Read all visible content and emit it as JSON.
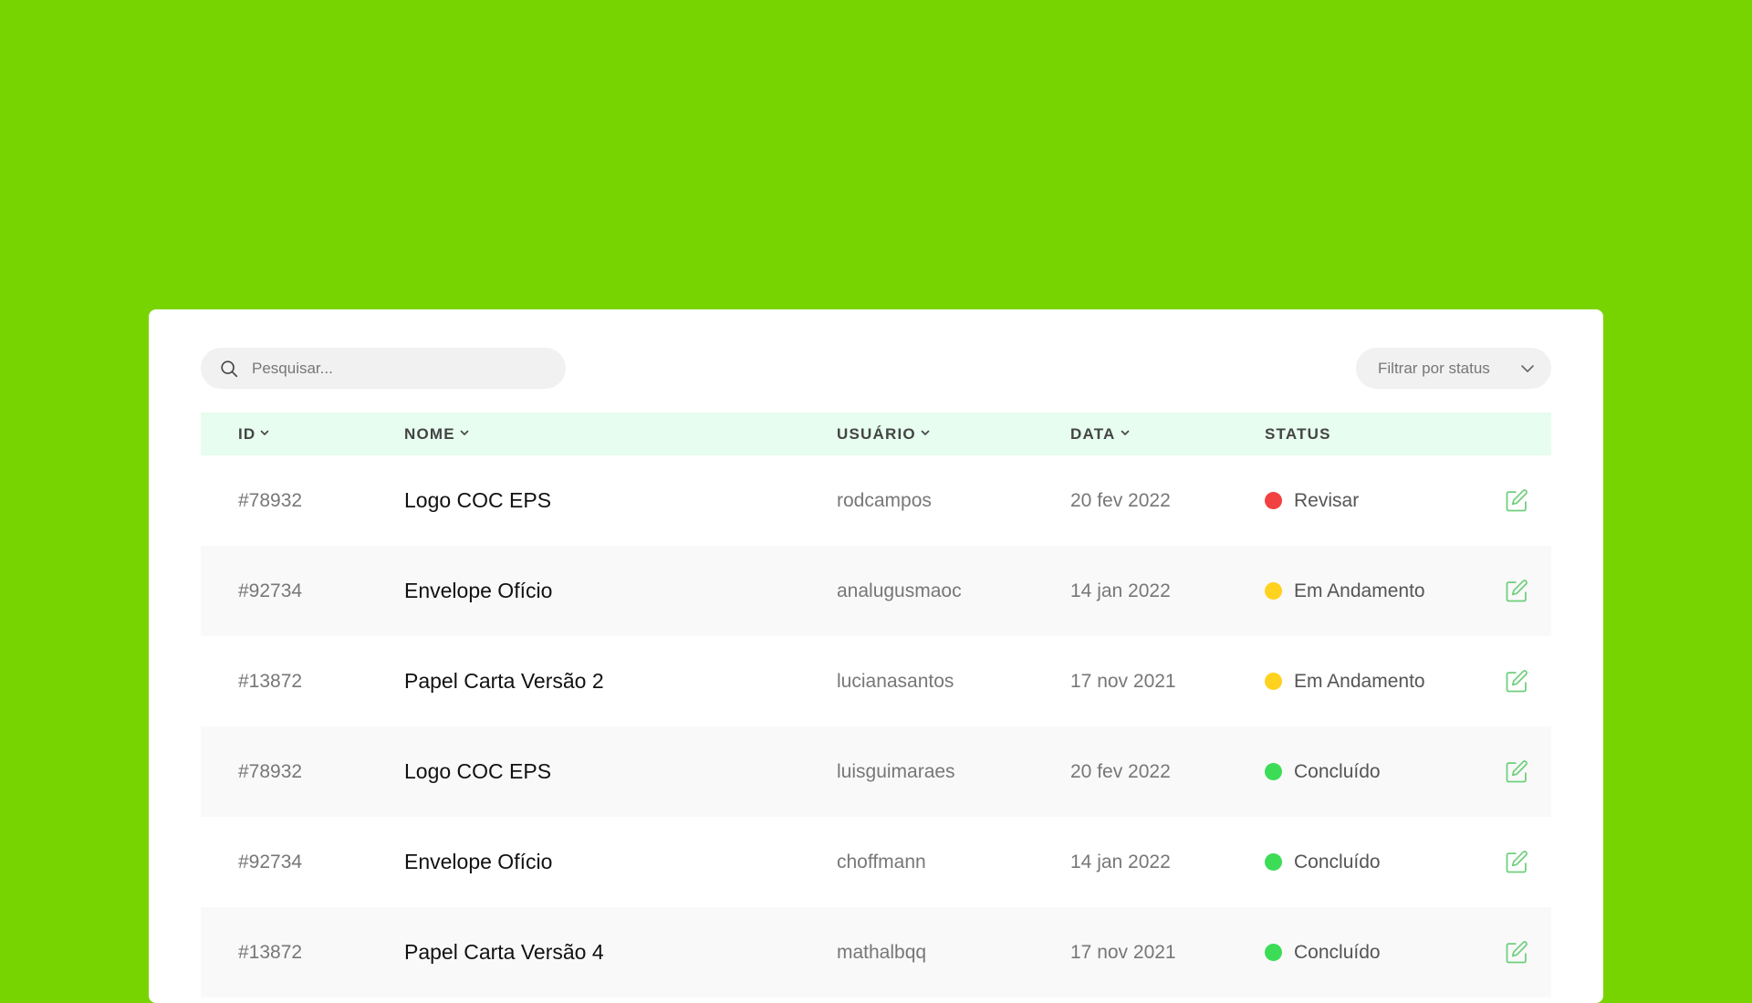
{
  "search": {
    "placeholder": "Pesquisar..."
  },
  "filter": {
    "label": "Filtrar por status"
  },
  "columns": {
    "id": "ID",
    "name": "NOME",
    "user": "USUÁRIO",
    "date": "DATA",
    "status": "STATUS"
  },
  "status_colors": {
    "Revisar": "#f24141",
    "Em Andamento": "#ffd21f",
    "Concluído": "#3ddc57"
  },
  "accent": "#78d400",
  "rows": [
    {
      "id": "#78932",
      "name": "Logo COC EPS",
      "user": "rodcampos",
      "date": "20 fev 2022",
      "status": "Revisar"
    },
    {
      "id": "#92734",
      "name": "Envelope Ofício",
      "user": "analugusmaoc",
      "date": "14 jan 2022",
      "status": "Em Andamento"
    },
    {
      "id": "#13872",
      "name": "Papel Carta Versão 2",
      "user": "lucianasantos",
      "date": "17 nov 2021",
      "status": "Em Andamento"
    },
    {
      "id": "#78932",
      "name": "Logo COC EPS",
      "user": "luisguimaraes",
      "date": "20 fev 2022",
      "status": "Concluído"
    },
    {
      "id": "#92734",
      "name": "Envelope Ofício",
      "user": "choffmann",
      "date": "14 jan 2022",
      "status": "Concluído"
    },
    {
      "id": "#13872",
      "name": "Papel Carta Versão 4",
      "user": "mathalbqq",
      "date": "17 nov 2021",
      "status": "Concluído"
    }
  ]
}
